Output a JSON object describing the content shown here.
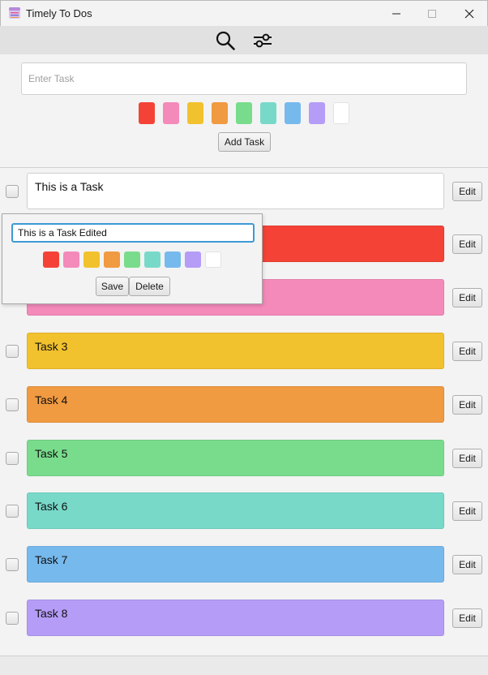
{
  "window": {
    "title": "Timely To Dos"
  },
  "toolbar": {
    "search_icon": "search-icon",
    "filter_icon": "filter-sliders-icon"
  },
  "add_task": {
    "placeholder": "Enter Task",
    "value": "",
    "button_label": "Add Task",
    "colors": [
      "#f44336",
      "#f48aba",
      "#f2c12e",
      "#f09a41",
      "#79dc8c",
      "#78d9c9",
      "#76b9ed",
      "#b59cf7",
      "#ffffff"
    ]
  },
  "tasks": [
    {
      "text": "This is a Task",
      "color": "#ffffff",
      "edit_label": "Edit"
    },
    {
      "text": "",
      "color": "#f44336",
      "edit_label": "Edit"
    },
    {
      "text": "",
      "color": "#f48aba",
      "edit_label": "Edit"
    },
    {
      "text": "Task 3",
      "color": "#f2c12e",
      "edit_label": "Edit"
    },
    {
      "text": "Task 4",
      "color": "#f09a41",
      "edit_label": "Edit"
    },
    {
      "text": "Task 5",
      "color": "#79dc8c",
      "edit_label": "Edit"
    },
    {
      "text": "Task 6",
      "color": "#78d9c9",
      "edit_label": "Edit"
    },
    {
      "text": "Task 7",
      "color": "#76b9ed",
      "edit_label": "Edit"
    },
    {
      "text": "Task 8",
      "color": "#b59cf7",
      "edit_label": "Edit"
    }
  ],
  "edit_popup": {
    "value": "This is a Task Edited",
    "save_label": "Save",
    "delete_label": "Delete",
    "colors": [
      "#f44336",
      "#f48aba",
      "#f2c12e",
      "#f09a41",
      "#79dc8c",
      "#78d9c9",
      "#76b9ed",
      "#b59cf7",
      "#ffffff"
    ]
  }
}
